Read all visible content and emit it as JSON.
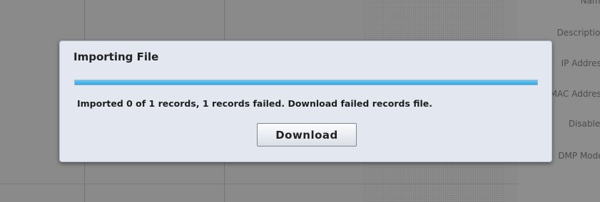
{
  "background": {
    "form_labels": [
      "Name",
      "Description",
      "IP Address",
      "MAC Address",
      "Disabled",
      "DMP Model"
    ]
  },
  "dialog": {
    "title": "Importing File",
    "progress_fraction": 1.0,
    "status_message": "Imported 0 of 1 records, 1 records failed. Download failed records file.",
    "download_label": "Download"
  },
  "colors": {
    "overlay": "#8a8a8a",
    "dialog_bg": "#e3e8f0",
    "progress_accent": "#2ea4e6"
  }
}
